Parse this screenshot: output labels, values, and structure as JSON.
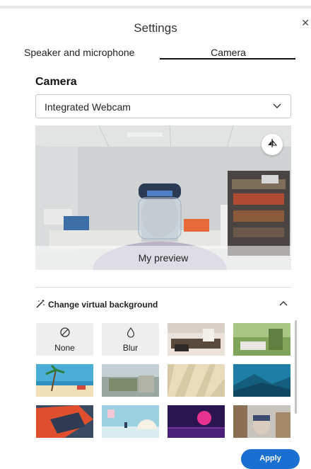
{
  "dialog": {
    "title": "Settings"
  },
  "tabs": {
    "speaker": "Speaker and microphone",
    "camera": "Camera"
  },
  "camera": {
    "section_title": "Camera",
    "device_selected": "Integrated Webcam",
    "preview_label": "My preview"
  },
  "virtual_background": {
    "label": "Change virtual background",
    "none_label": "None",
    "blur_label": "Blur"
  },
  "actions": {
    "apply": "Apply"
  },
  "colors": {
    "accent": "#1b6fd1"
  }
}
